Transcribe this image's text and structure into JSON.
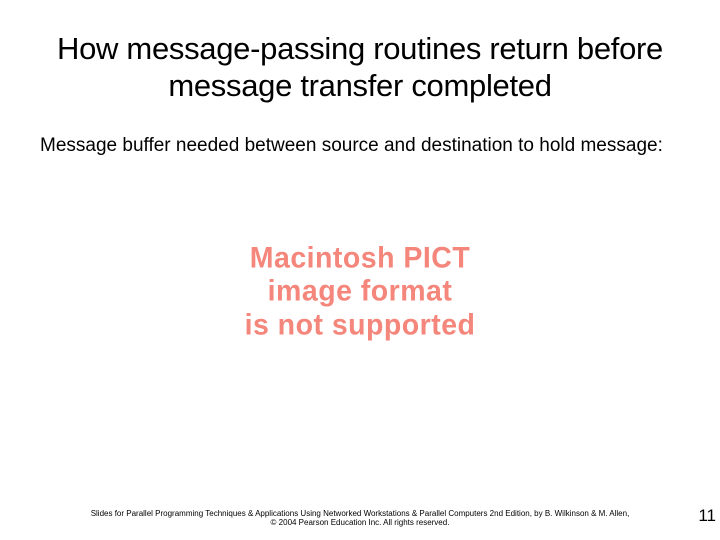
{
  "title": "How message-passing routines return before message transfer completed",
  "body": "Message buffer needed between source and destination to hold message:",
  "placeholder": {
    "line1": "Macintosh PICT",
    "line2": "image format",
    "line3": "is not supported"
  },
  "footer": {
    "line1": "Slides for Parallel Programming Techniques & Applications Using Networked Workstations & Parallel Computers 2nd Edition, by B. Wilkinson & M. Allen,",
    "line2": "© 2004 Pearson Education Inc. All rights reserved."
  },
  "page_number": "11"
}
